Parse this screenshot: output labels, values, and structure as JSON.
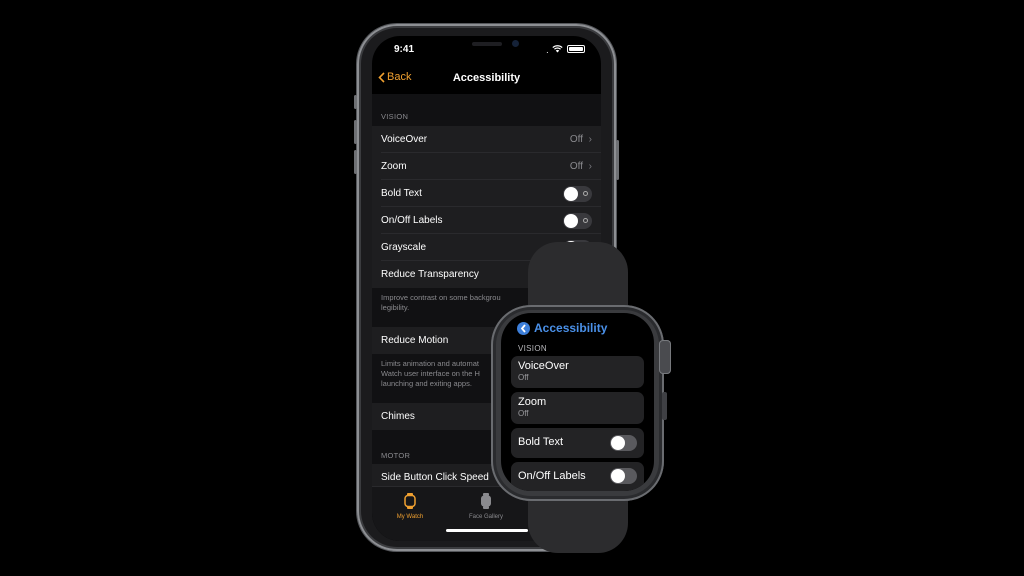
{
  "status": {
    "time": "9:41"
  },
  "nav": {
    "back_label": "Back",
    "title": "Accessibility"
  },
  "sections": {
    "vision_header": "VISION",
    "motor_header": "MOTOR"
  },
  "vision_items": {
    "voiceover": {
      "label": "VoiceOver",
      "value": "Off"
    },
    "zoom": {
      "label": "Zoom",
      "value": "Off"
    },
    "bold_text": {
      "label": "Bold Text",
      "on": false
    },
    "onoff_labels": {
      "label": "On/Off Labels",
      "on": false
    },
    "grayscale": {
      "label": "Grayscale"
    },
    "reduce_transparency": {
      "label": "Reduce Transparency"
    }
  },
  "footers": {
    "transparency_line1": "Improve contrast on some backgrou",
    "transparency_line2": "legibility.",
    "motion_line1": "Limits animation and automat",
    "motion_line2": "Watch user interface on the H",
    "motion_line3": "launching and exiting apps."
  },
  "reduce_motion": {
    "label": "Reduce Motion"
  },
  "chimes": {
    "label": "Chimes"
  },
  "motor_items": {
    "side_button": {
      "label": "Side Button Click Speed"
    }
  },
  "tabbar": {
    "my_watch": "My Watch",
    "face_gallery": "Face Gallery"
  },
  "watch": {
    "title": "Accessibility",
    "section": "VISION",
    "voiceover": {
      "label": "VoiceOver",
      "value": "Off"
    },
    "zoom": {
      "label": "Zoom",
      "value": "Off"
    },
    "bold_text": {
      "label": "Bold Text",
      "on": false
    },
    "onoff_labels": {
      "label": "On/Off Labels",
      "on": false
    }
  },
  "colors": {
    "accent_orange": "#f0a030",
    "watch_blue": "#4a90e8",
    "background": "#000000"
  }
}
